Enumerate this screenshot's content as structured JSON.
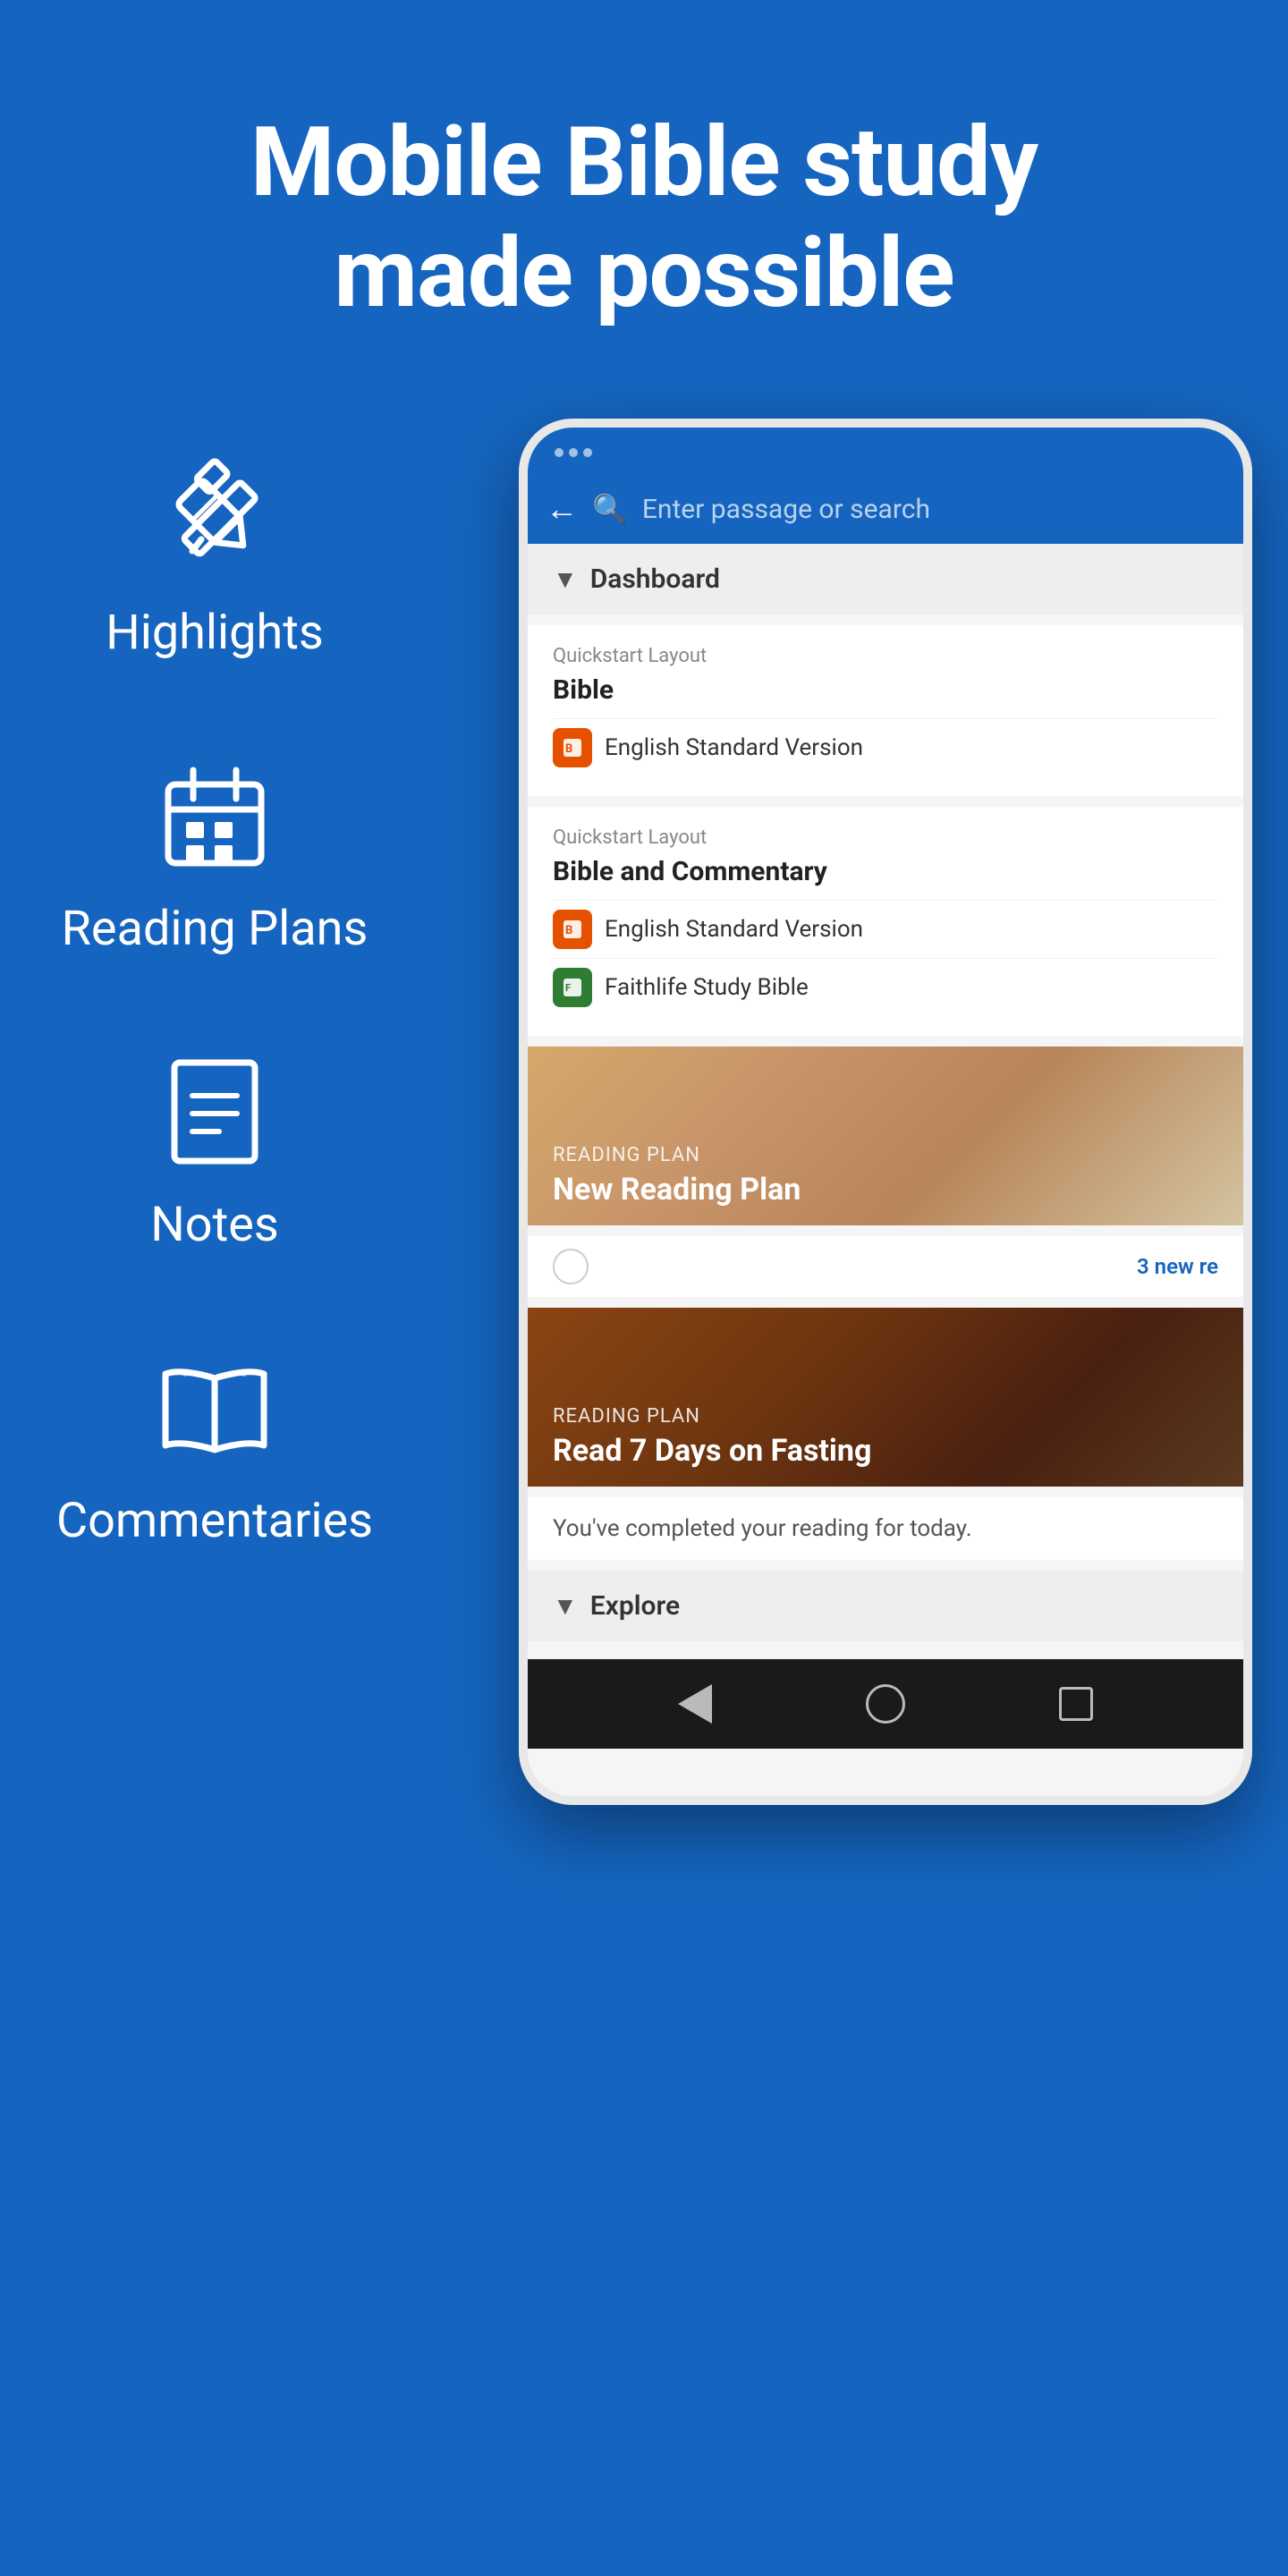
{
  "hero": {
    "title_line1": "Mobile Bible study",
    "title_line2": "made possible"
  },
  "icons": [
    {
      "id": "highlights",
      "label": "Highlights",
      "icon_type": "pen"
    },
    {
      "id": "reading_plans",
      "label": "Reading Plans",
      "icon_type": "calendar"
    },
    {
      "id": "notes",
      "label": "Notes",
      "icon_type": "document"
    },
    {
      "id": "commentaries",
      "label": "Commentaries",
      "icon_type": "book"
    }
  ],
  "phone": {
    "search_placeholder": "Enter passage or search",
    "dashboard_label": "Dashboard",
    "quickstart1": {
      "label": "Quickstart Layout",
      "title": "Bible",
      "resources": [
        {
          "name": "English Standard Version",
          "color": "orange"
        }
      ]
    },
    "quickstart2": {
      "label": "Quickstart Layout",
      "title": "Bible and Commentary",
      "resources": [
        {
          "name": "English Standard Version",
          "color": "orange"
        },
        {
          "name": "Faithlife Study Bible",
          "color": "green"
        }
      ]
    },
    "reading_plan1": {
      "label": "Reading Plan",
      "title": "New Reading Plan",
      "badge": "3 new re",
      "style": "new"
    },
    "reading_plan2": {
      "label": "Reading Plan",
      "title": "Read 7 Days on Fasting",
      "completed_text": "You've completed your reading for today.",
      "style": "fasting"
    },
    "explore_label": "Explore",
    "nav": {
      "back": "◀",
      "home": "●",
      "recent": "■"
    }
  }
}
